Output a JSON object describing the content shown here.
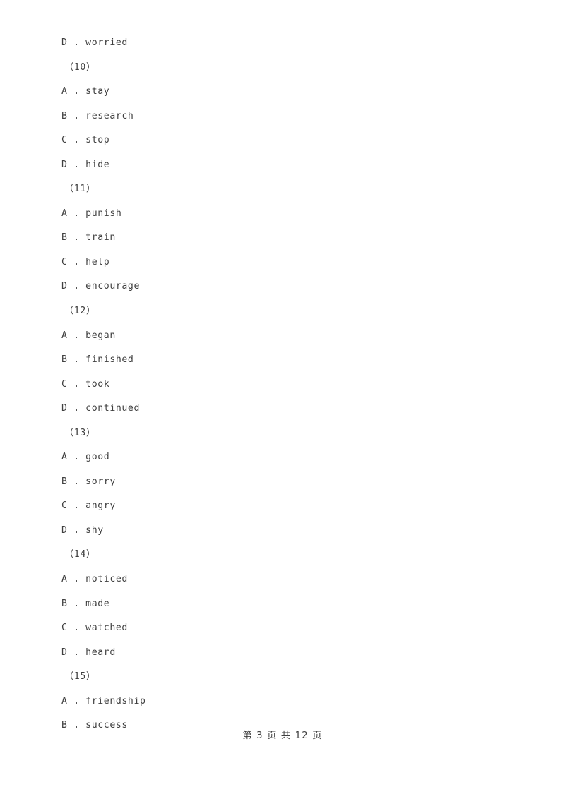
{
  "document": {
    "type": "exam-paper-multiple-choice-options",
    "lines": [
      {
        "kind": "option",
        "text": "D . worried"
      },
      {
        "kind": "question",
        "text": "（10）"
      },
      {
        "kind": "option",
        "text": "A . stay"
      },
      {
        "kind": "option",
        "text": "B . research"
      },
      {
        "kind": "option",
        "text": "C . stop"
      },
      {
        "kind": "option",
        "text": "D . hide"
      },
      {
        "kind": "question",
        "text": "（11）"
      },
      {
        "kind": "option",
        "text": "A . punish"
      },
      {
        "kind": "option",
        "text": "B . train"
      },
      {
        "kind": "option",
        "text": "C . help"
      },
      {
        "kind": "option",
        "text": "D . encourage"
      },
      {
        "kind": "question",
        "text": "（12）"
      },
      {
        "kind": "option",
        "text": "A . began"
      },
      {
        "kind": "option",
        "text": "B . finished"
      },
      {
        "kind": "option",
        "text": "C . took"
      },
      {
        "kind": "option",
        "text": "D . continued"
      },
      {
        "kind": "question",
        "text": "（13）"
      },
      {
        "kind": "option",
        "text": "A . good"
      },
      {
        "kind": "option",
        "text": "B . sorry"
      },
      {
        "kind": "option",
        "text": "C . angry"
      },
      {
        "kind": "option",
        "text": "D . shy"
      },
      {
        "kind": "question",
        "text": "（14）"
      },
      {
        "kind": "option",
        "text": "A . noticed"
      },
      {
        "kind": "option",
        "text": "B . made"
      },
      {
        "kind": "option",
        "text": "C . watched"
      },
      {
        "kind": "option",
        "text": "D . heard"
      },
      {
        "kind": "question",
        "text": "（15）"
      },
      {
        "kind": "option",
        "text": "A . friendship"
      },
      {
        "kind": "option",
        "text": "B . success"
      }
    ]
  },
  "footer": {
    "text": "第 3 页 共 12 页",
    "current_page": "3",
    "total_pages": "12"
  },
  "colors": {
    "text": "#3f3f3f",
    "background": "#ffffff"
  }
}
